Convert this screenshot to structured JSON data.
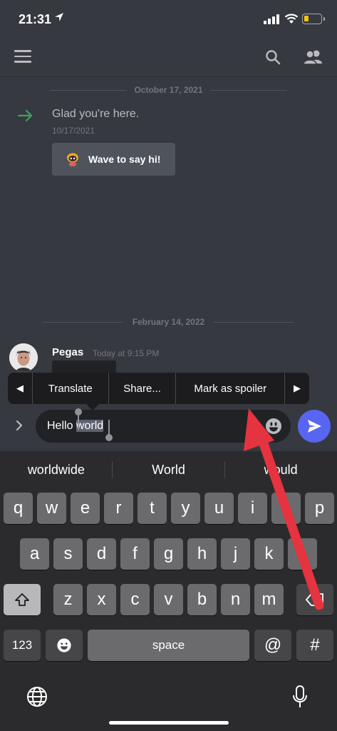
{
  "status_bar": {
    "time": "21:31"
  },
  "channel": {
    "dividers": [
      "October 17, 2021",
      "February 14, 2022"
    ],
    "join_message": {
      "text": "Glad you're here.",
      "date": "10/17/2021",
      "wave_button": "Wave to say hi!"
    },
    "message": {
      "author": "Pegas",
      "timestamp": "Today at 9:15 PM"
    }
  },
  "context_menu": {
    "items": [
      "Translate",
      "Share...",
      "Mark as spoiler"
    ]
  },
  "composer": {
    "text_before": "Hello ",
    "selected_text": "world"
  },
  "keyboard": {
    "predictions": [
      "worldwide",
      "World",
      "would"
    ],
    "row1": [
      "q",
      "w",
      "e",
      "r",
      "t",
      "y",
      "u",
      "i",
      "o",
      "p"
    ],
    "row2": [
      "a",
      "s",
      "d",
      "f",
      "g",
      "h",
      "j",
      "k",
      "l"
    ],
    "row3": [
      "z",
      "x",
      "c",
      "v",
      "b",
      "n",
      "m"
    ],
    "numbers_key": "123",
    "space_key": "space",
    "at_key": "@",
    "hash_key": "#"
  },
  "colors": {
    "background": "#36393f",
    "accent": "#5865f2",
    "annotation": "#e5333f"
  }
}
